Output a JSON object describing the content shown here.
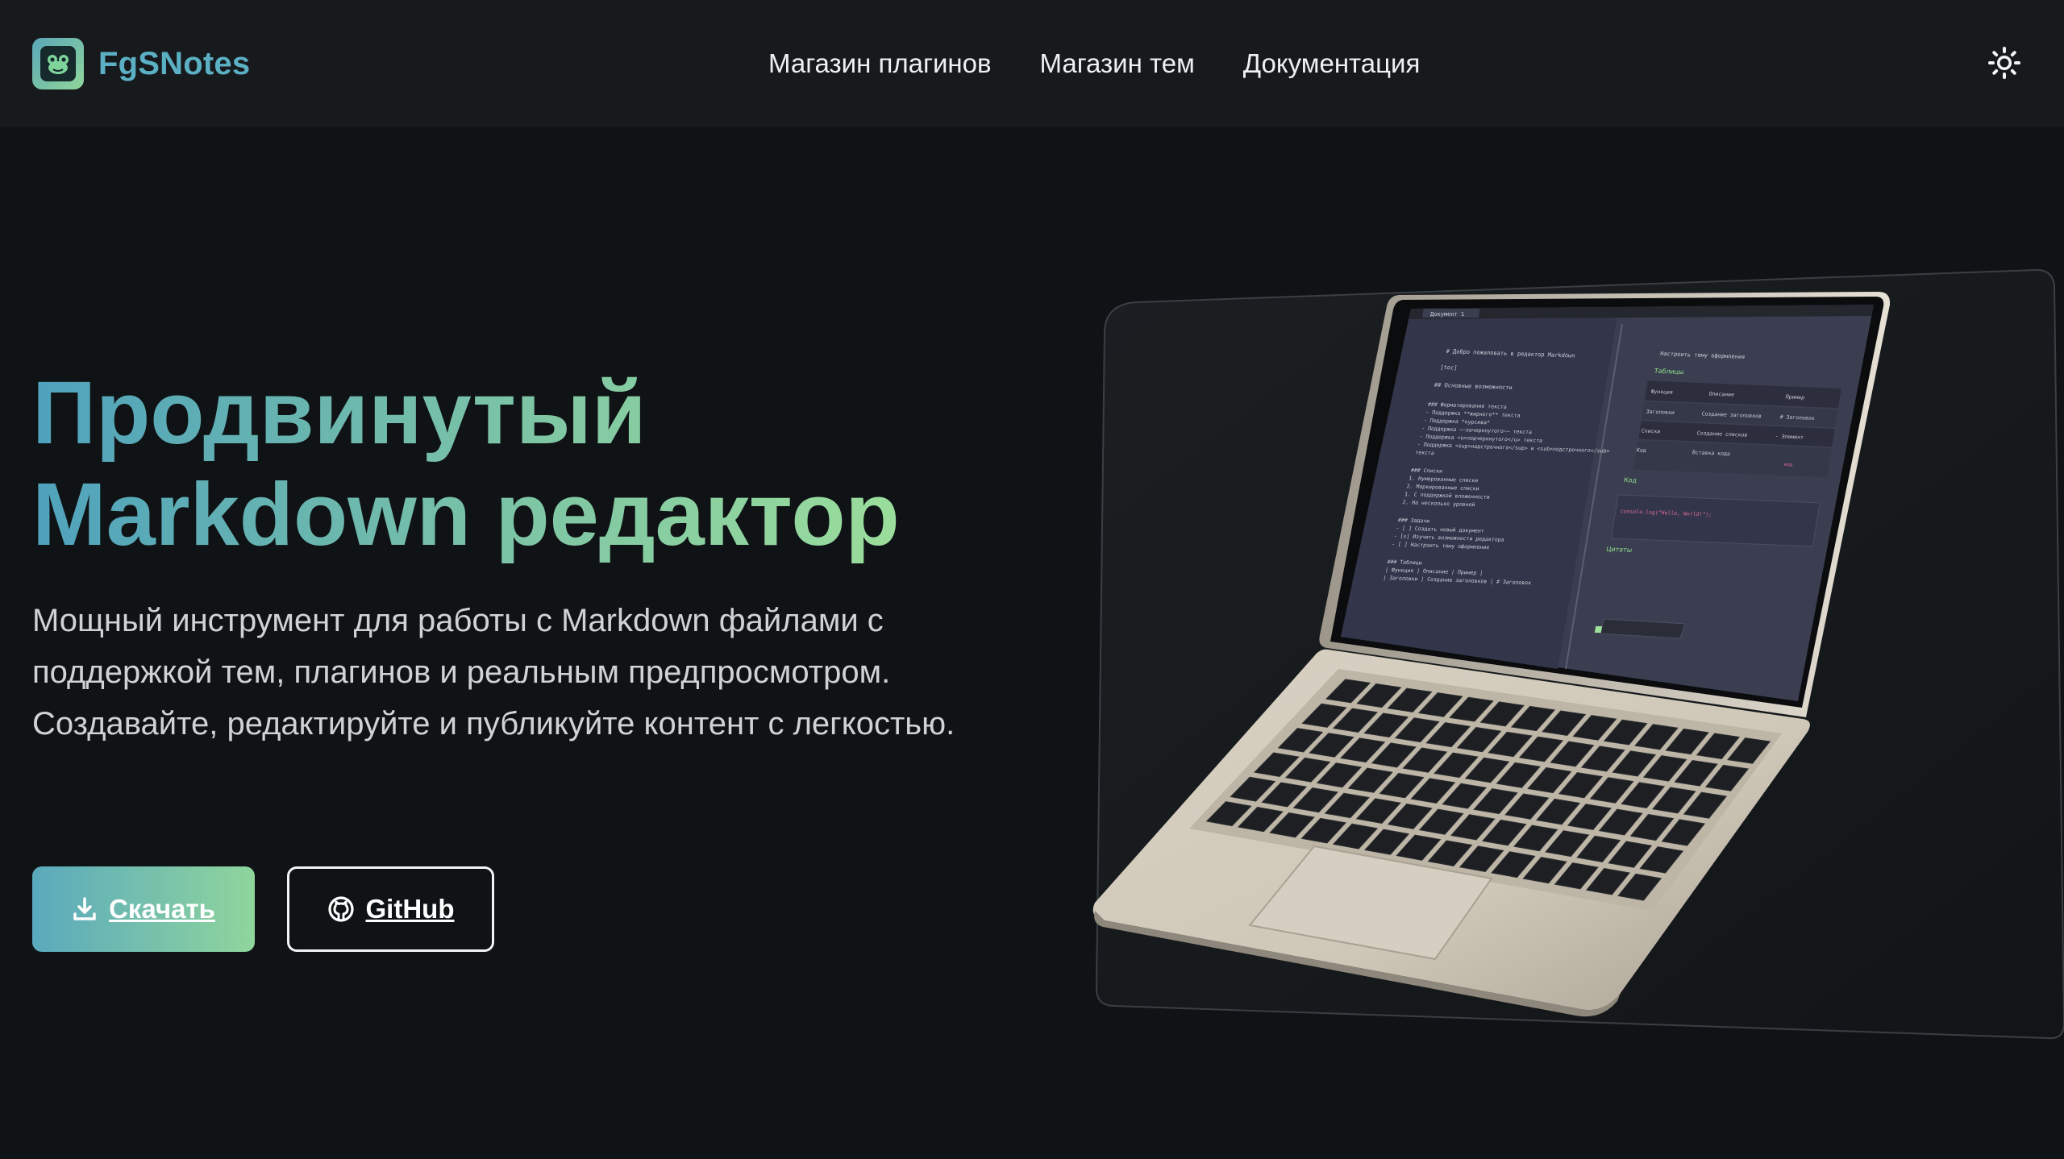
{
  "header": {
    "brand": "FgSNotes",
    "nav": [
      {
        "label": "Магазин плагинов"
      },
      {
        "label": "Магазин тем"
      },
      {
        "label": "Документация"
      }
    ],
    "theme_toggle_icon": "sun-icon"
  },
  "hero": {
    "title_line1": "Продвинутый",
    "title_line2": "Markdown редактор",
    "description": "Мощный инструмент для работы с Markdown файлами с поддержкой тем, плагинов и реальным предпросмотром. Создавайте, редактируйте и публикуйте контент с легкостью.",
    "download_label": "Скачать",
    "download_icon": "download-icon",
    "github_label": "GitHub",
    "github_icon": "github-icon"
  },
  "colors": {
    "background": "#101315",
    "header": "#171a1d",
    "gradient_start": "#4fa2bd",
    "gradient_end": "#9fe19a"
  },
  "laptop_screen": {
    "tab_label": "Документ 1",
    "editor_lines": [
      "# Добро пожаловать в редактор Markdown",
      "[toc]",
      "## Основные возможности",
      "### Форматирование текста",
      "- Поддержка **жирного** текста",
      "- Поддержка *курсива*",
      "- Поддержка ~~зачеркнутого~~ текста",
      "- Поддержка <u>подчеркнутого</u> текста",
      "- Поддержка <sup>надстрочного</sup> и <sub>подстрочного</sub>",
      "текста",
      "### Списки",
      "1. Нумерованные списки",
      "2. Маркированные списки",
      "   1. С поддержкой вложенности",
      "   2. На несколько уровней",
      "### Задачи",
      "- [ ] Создать новый документ",
      "- [x] Изучить возможности редактора",
      "- [ ] Настроить тему оформления",
      "### Таблицы",
      "| Функция | Описание | Пример |",
      "| Заголовки | Создание заголовков | # Заголовок"
    ],
    "preview_task": "Настроить тему оформления",
    "preview_tables_heading": "Таблицы",
    "preview_table_header": [
      "Функция",
      "Описание",
      "Пример"
    ],
    "preview_table_rows": [
      [
        "Заголовки",
        "Создание заголовков",
        "# Заголовок"
      ],
      [
        "Списки",
        "Создание списков",
        "- Элемент"
      ],
      [
        "Код",
        "Вставка кода",
        "код"
      ]
    ],
    "preview_code_heading": "Код",
    "preview_code": "console.log(\"Hello, World!\");",
    "preview_quotes_heading": "Цитаты"
  }
}
